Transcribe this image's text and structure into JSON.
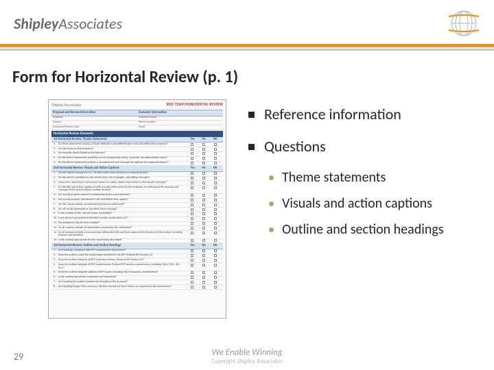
{
  "header": {
    "logo_bold": "Shipley",
    "logo_light": "Associates"
  },
  "title": "Form for Horizontal Review (p. 1)",
  "form": {
    "logo": "Shipley Associates",
    "banner": "RED TEAM HORIZONTAL REVIEW",
    "info_left": "Proposal and Review Information",
    "info_right": "Evaluator Information",
    "sub_left": [
      "Proposal:",
      "Section:",
      "Horizontal Review Type:"
    ],
    "sub_right": [
      "Evaluator Name:",
      "Phone Number:",
      "Email:"
    ],
    "elements_head": "Horizontal Review Elements",
    "cols": [
      "Yes",
      "No",
      "NA"
    ],
    "sections": [
      {
        "title": "1st Horizontal Review: Theme Statements",
        "rows": [
          "Do these statements contain a clearly defined or quantified feature and a benefit to the customer?",
          "Are the features discriminators?",
          "Are benefits clearly linked to the features?",
          "Do the theme statements avoid the use of unsupported claims, especially unsubstantiated claims?",
          "Do the theme statements present a consistent win-win message throughout the proposal/volume?"
        ]
      },
      {
        "title": "2nd Horizontal Review: Visuals and Action Captions",
        "rows": [
          "Are the visuals standalone (i.e., do they make sense without accompanying text)?",
          "Do the visuals contribute to the overall story, win strategies, and selling messages?",
          "Does every visual have a persuasive action (or sales) caption that reinforces the visual's message?",
          "Do the title and action caption provide enough information for the evaluator to understand the purpose and message of the visual without reading the text?",
          "Are visuals properly placed in relationship to the associated text?",
          "Are visuals properly introduced in the text before they appear?",
          "Are the visuals simple, uncluttered and easy to understand?",
          "Are all visuals generated or provided (none missing)?",
          "Is the content of the 'call out' boxes compelling?",
          "Is any glossy-type material included to make a point that isn't?",
          "Has gratuitous clip art been avoided?",
          "Do all captions include all information required by the solicitation?",
          "Do all sections include a summary that follows the title and that captures the relevance of the section, including features and benefits?",
          "Is the content appropriate for the visual being described?"
        ]
      },
      {
        "title": "3rd Horizontal Review: Outline and Section Headings",
        "rows": [
          "Are headings compliant with RFP requirements/instructions?",
          "Does the outline match the organization specified in the RFP (Federal RFP Section L)?",
          "Does the outline interpret all RFP evaluation factors (Federal RFP Section M)?",
          "Does the outline integrate all RFP requirements (Federal RFP section requirements, including SOW, CDRL, DID, etc.)?",
          "Does the outline integrate additional RFP inputs, including Q&A responses, amendments?",
          "Is the numbering scheme consistent and sequential?",
          "Are headings formatted consistently throughout the proposal?",
          "Are headings longer than necessary (do they exceed one line) where not required by the instructions?"
        ]
      }
    ]
  },
  "bullets": {
    "b1a": "Reference information",
    "b1b": "Questions",
    "b2a": "Theme statements",
    "b2b": "Visuals and action captions",
    "b2c": "Outline and section headings"
  },
  "footer": {
    "page": "29",
    "tagline": "We Enable Winning",
    "copy": "Copyright Shipley Associates"
  }
}
